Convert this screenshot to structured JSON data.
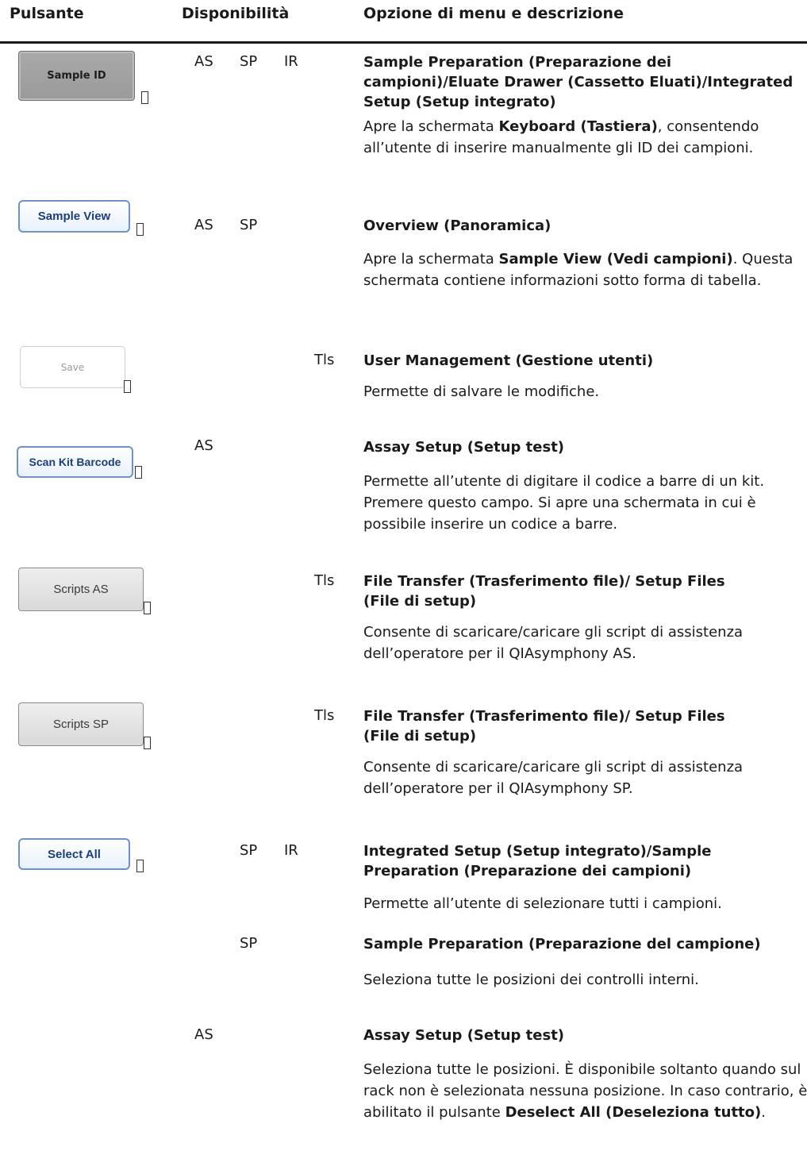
{
  "header": {
    "col_button": "Pulsante",
    "col_availability": "Disponibilità",
    "col_option": "Opzione di menu e descrizione"
  },
  "rows": [
    {
      "button_label": "Sample ID",
      "avail": [
        "AS",
        "SP",
        "IR"
      ],
      "title": "Sample Preparation (Preparazione dei campioni)/Eluate Drawer (Cassetto Eluati)/Integrated Setup (Setup integrato)",
      "desc_pre": "Apre la schermata ",
      "desc_bold": "Keyboard (Tastiera)",
      "desc_post": ", consentendo all’utente di inserire manualmente gli ID dei campioni."
    },
    {
      "button_label": "Sample View",
      "avail": [
        "AS",
        "SP"
      ],
      "title": "Overview (Panoramica)",
      "desc_pre": "Apre la schermata ",
      "desc_bold": "Sample View (Vedi campioni)",
      "desc_post": ". Questa schermata contiene informazioni sotto forma di tabella."
    },
    {
      "button_label": "Save",
      "avail": [
        "Tls"
      ],
      "title": "User Management (Gestione utenti)",
      "desc": "Permette di salvare le modifiche."
    },
    {
      "button_label": "Scan Kit Barcode",
      "avail": [
        "AS"
      ],
      "title": "Assay Setup (Setup test)",
      "desc": "Permette all’utente di digitare il codice a barre di un kit. Premere questo campo. Si apre una schermata in cui è possibile inserire un codice a barre."
    },
    {
      "button_label": "Scripts AS",
      "avail": [
        "Tls"
      ],
      "title_line1": "File Transfer (Trasferimento file)/ Setup Files",
      "title_line2": "(File di setup)",
      "desc": "Consente di scaricare/caricare gli script di assistenza dell’operatore per il QIAsymphony AS."
    },
    {
      "button_label": "Scripts SP",
      "avail": [
        "Tls"
      ],
      "title_line1": "File Transfer (Trasferimento file)/ Setup Files",
      "title_line2": "(File di setup)",
      "desc": "Consente di scaricare/caricare gli script di assistenza dell’operatore per il QIAsymphony SP."
    },
    {
      "button_label": "Select All",
      "avail": [
        "SP",
        "IR"
      ],
      "title_line1": "Integrated Setup (Setup integrato)/Sample",
      "title_line2": "Preparation (Preparazione dei campioni)",
      "desc": "Permette all’utente di selezionare tutti i campioni."
    },
    {
      "avail": [
        "SP"
      ],
      "title": "Sample Preparation (Preparazione del campione)",
      "desc": "Seleziona tutte le posizioni dei controlli interni."
    },
    {
      "avail": [
        "AS"
      ],
      "title": "Assay Setup (Setup test)",
      "desc_pre": "Seleziona tutte le posizioni. È disponibile soltanto quando sul rack non è selezionata nessuna posizione. In caso contrario, è abilitato il pulsante ",
      "desc_bold": "Deselect All (Deseleziona tutto)",
      "desc_post": "."
    }
  ]
}
